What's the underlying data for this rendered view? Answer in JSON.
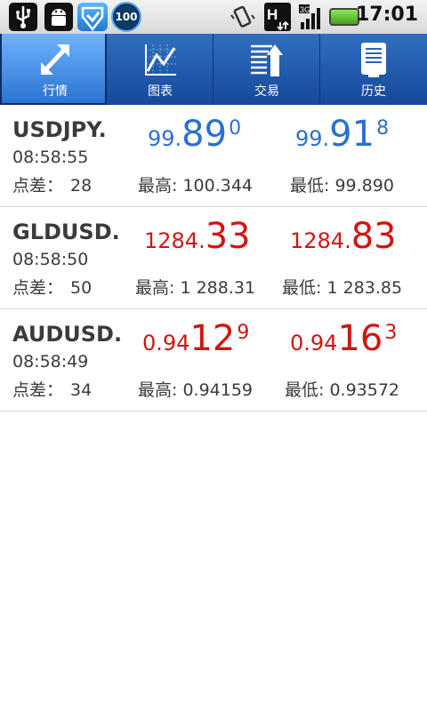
{
  "status_bar": {
    "badge": "100",
    "clock": "17:01"
  },
  "tabs": [
    {
      "label": "行情",
      "icon": "resize-arrows-icon",
      "active": true
    },
    {
      "label": "图表",
      "icon": "line-chart-icon",
      "active": false
    },
    {
      "label": "交易",
      "icon": "trade-list-icon",
      "active": false
    },
    {
      "label": "历史",
      "icon": "history-doc-icon",
      "active": false
    }
  ],
  "quotes": [
    {
      "symbol": "USDJPY.",
      "time": "08:58:55",
      "spread_label": "点差：",
      "spread": "28",
      "bid": {
        "small": "99.",
        "big": "89",
        "sup": "0"
      },
      "ask": {
        "small": "99.",
        "big": "91",
        "sup": "8"
      },
      "color": "#2a6fd3",
      "high_label": "最高:",
      "high": "100.344",
      "low_label": "最低:",
      "low": "99.890"
    },
    {
      "symbol": "GLDUSD.",
      "time": "08:58:50",
      "spread_label": "点差：",
      "spread": "50",
      "bid": {
        "small": "1284.",
        "big": "33",
        "sup": ""
      },
      "ask": {
        "small": "1284.",
        "big": "83",
        "sup": ""
      },
      "color": "#d2150f",
      "high_label": "最高:",
      "high": "1 288.31",
      "low_label": "最低:",
      "low": "1 283.85"
    },
    {
      "symbol": "AUDUSD.",
      "time": "08:58:49",
      "spread_label": "点差：",
      "spread": "34",
      "bid": {
        "small": "0.94",
        "big": "12",
        "sup": "9"
      },
      "ask": {
        "small": "0.94",
        "big": "16",
        "sup": "3"
      },
      "color": "#d2150f",
      "high_label": "最高:",
      "high": "0.94159",
      "low_label": "最低:",
      "low": "0.93572"
    }
  ]
}
